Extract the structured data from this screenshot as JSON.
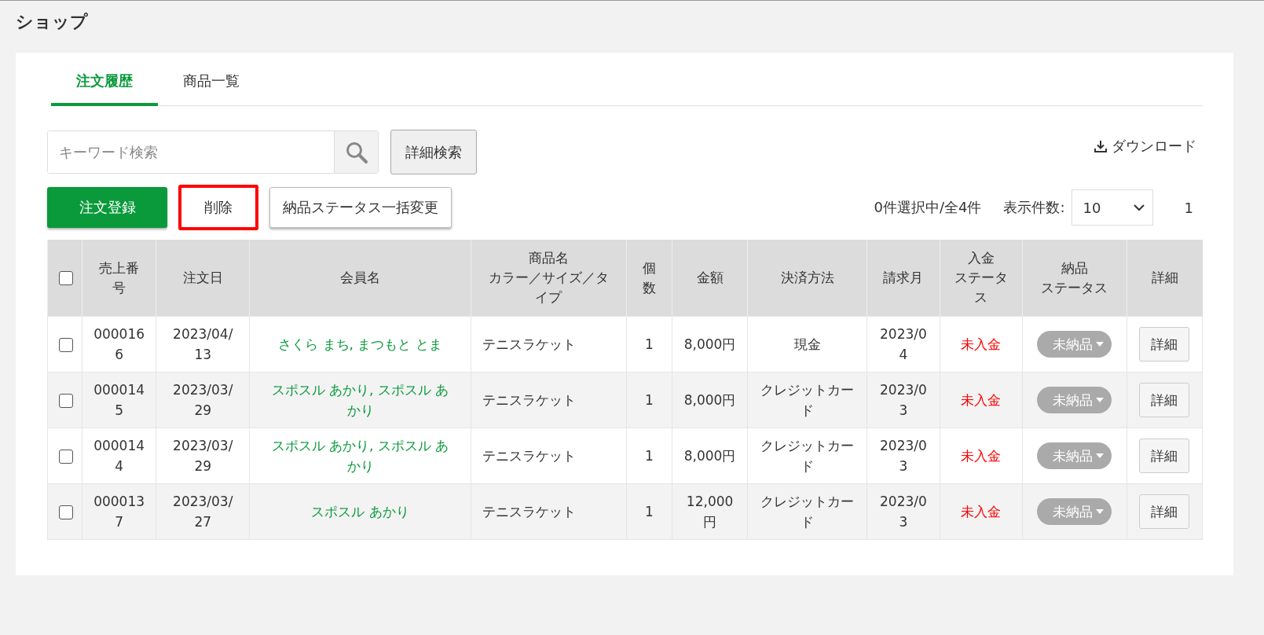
{
  "page_title": "ショップ",
  "tabs": [
    {
      "label": "注文履歴",
      "selected": true
    },
    {
      "label": "商品一覧",
      "selected": false
    }
  ],
  "search": {
    "placeholder": "キーワード検索"
  },
  "advanced_search_button": "詳細検索",
  "download_link": "ダウンロード",
  "actions": [
    {
      "label": "注文登録",
      "kind": "primary",
      "highlighted": false
    },
    {
      "label": "削除",
      "kind": "plain",
      "highlighted": true
    },
    {
      "label": "納品ステータス一括変更",
      "kind": "raised",
      "highlighted": false
    }
  ],
  "selection_summary": "0件選択中/全4件",
  "page_size_label": "表示件数:",
  "page_size": "10",
  "pagination": "1",
  "table": {
    "select_all_checked": false,
    "columns": [
      [
        "売上番号"
      ],
      [
        "注文日"
      ],
      [
        "会員名"
      ],
      [
        "商品名",
        "カラー／サイズ／タイプ"
      ],
      [
        "個数"
      ],
      [
        "金額"
      ],
      [
        "決済方法"
      ],
      [
        "請求月"
      ],
      [
        "入金",
        "ステータス"
      ],
      [
        "納品",
        "ステータス"
      ],
      [
        "詳細"
      ]
    ],
    "rows": [
      {
        "checked": false,
        "sales_no": "0000166",
        "order_date": "2023/04/13",
        "member": "さくら まち, まつもと とま",
        "product": "テニスラケット",
        "qty": "1",
        "amount": "8,000円",
        "payment": "現金",
        "billing_month": "2023/04",
        "payment_status": "未入金",
        "delivery_status": "未納品",
        "detail": "詳細"
      },
      {
        "checked": false,
        "sales_no": "0000145",
        "order_date": "2023/03/29",
        "member": "スポスル あかり, スポスル あかり",
        "product": "テニスラケット",
        "qty": "1",
        "amount": "8,000円",
        "payment": "クレジットカード",
        "billing_month": "2023/03",
        "payment_status": "未入金",
        "delivery_status": "未納品",
        "detail": "詳細"
      },
      {
        "checked": false,
        "sales_no": "0000144",
        "order_date": "2023/03/29",
        "member": "スポスル あかり, スポスル あかり",
        "product": "テニスラケット",
        "qty": "1",
        "amount": "8,000円",
        "payment": "クレジットカード",
        "billing_month": "2023/03",
        "payment_status": "未入金",
        "delivery_status": "未納品",
        "detail": "詳細"
      },
      {
        "checked": false,
        "sales_no": "0000137",
        "order_date": "2023/03/27",
        "member": "スポスル あかり",
        "product": "テニスラケット",
        "qty": "1",
        "amount": "12,000円",
        "payment": "クレジットカード",
        "billing_month": "2023/03",
        "payment_status": "未入金",
        "delivery_status": "未納品",
        "detail": "詳細"
      }
    ]
  }
}
